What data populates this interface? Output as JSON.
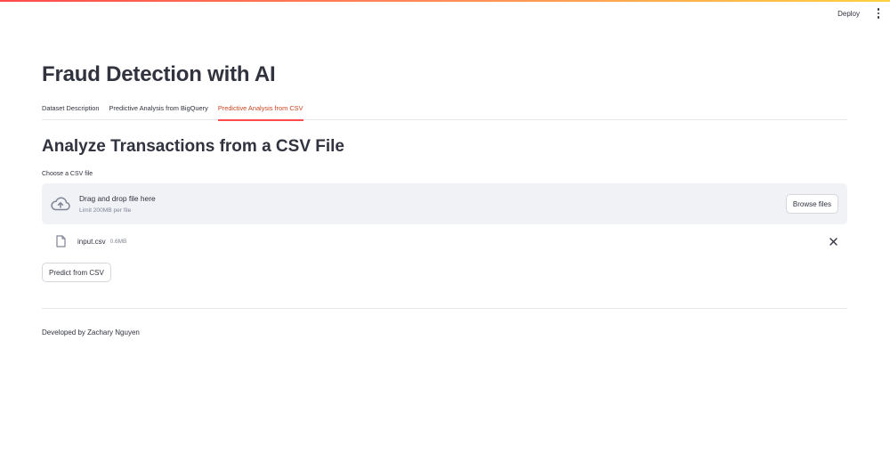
{
  "header": {
    "deploy_label": "Deploy",
    "menu_icon": "kebab-menu-icon",
    "accent_gradient": [
      "#ff4b4b",
      "#ff8c5a",
      "#ffd23f"
    ]
  },
  "main": {
    "title": "Fraud Detection with AI",
    "tabs": [
      {
        "label": "Dataset Description",
        "active": false
      },
      {
        "label": "Predictive Analysis from BigQuery",
        "active": false
      },
      {
        "label": "Predictive Analysis from CSV",
        "active": true
      }
    ],
    "section_title": "Analyze Transactions from a CSV File",
    "uploader": {
      "label": "Choose a CSV file",
      "dropzone_text": "Drag and drop file here",
      "limit_text": "Limit 200MB per file",
      "browse_label": "Browse files",
      "icon": "cloud-upload-icon"
    },
    "uploaded_file": {
      "name": "input.csv",
      "size": "0.6MB",
      "icon": "file-icon",
      "remove_icon": "close-icon"
    },
    "predict_button_label": "Predict from CSV",
    "footer": "Developed by Zachary Nguyen"
  },
  "colors": {
    "active_tab": "#c8461f",
    "active_tab_underline": "#ff4b4b",
    "dropzone_bg": "#f0f2f6",
    "text": "#31333f",
    "muted_text": "#808495"
  }
}
